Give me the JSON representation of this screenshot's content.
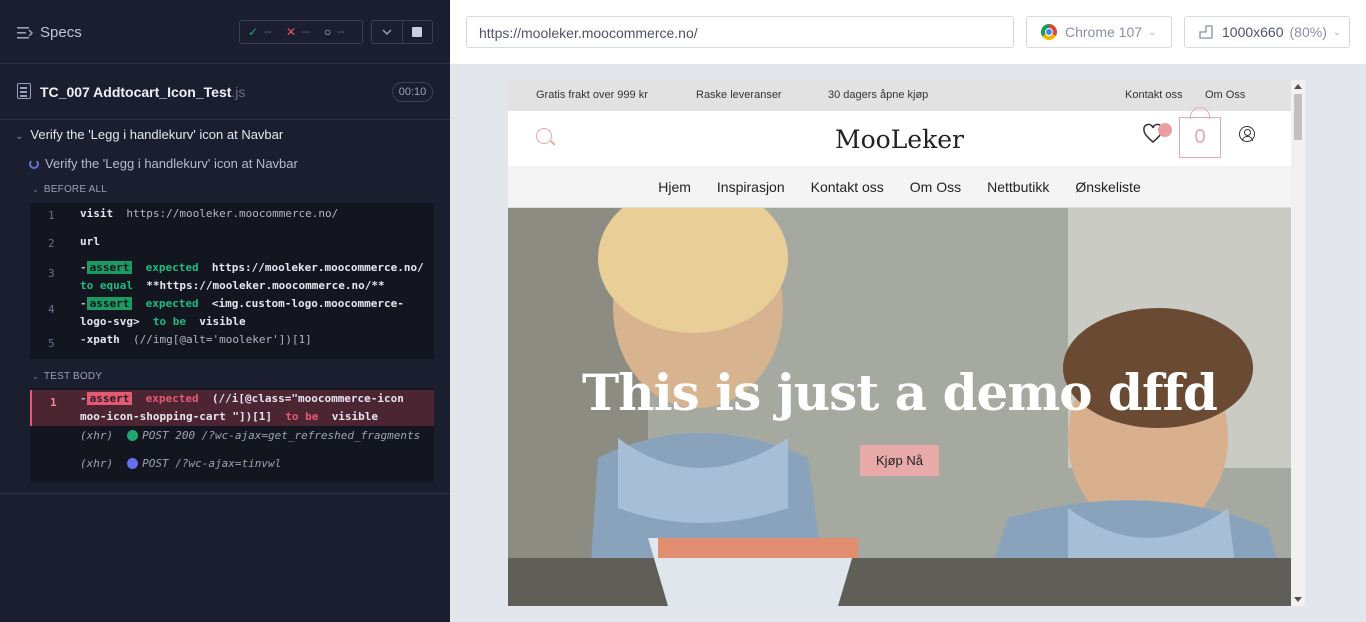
{
  "runner": {
    "specs_label": "Specs",
    "stats": {
      "passed": "--",
      "failed": "--",
      "pending": "--"
    },
    "spec_file": {
      "name": "TC_007 Addtocart_Icon_Test",
      "ext": ".js"
    },
    "duration": "00:10",
    "suite_title": "Verify the 'Legg i handlekurv' icon at Navbar",
    "test_title": "Verify the 'Legg i handlekurv' icon at Navbar",
    "before_all_label": "BEFORE ALL",
    "test_body_label": "TEST BODY",
    "before_all": [
      {
        "num": "1",
        "cmd": "visit",
        "arg": "https://mooleker.moocommerce.no/"
      },
      {
        "num": "2",
        "cmd": "url",
        "arg": ""
      },
      {
        "num": "3",
        "cmd": "assert",
        "l1_kw": "expected",
        "l1_val": "https://mooleker.moocommerce.no/",
        "l2_kw": "to equal",
        "l2_val": "**https://mooleker.moocommerce.no/**"
      },
      {
        "num": "4",
        "cmd": "assert",
        "l1_kw": "expected",
        "l1_val": "<img.custom-logo.moocommerce-",
        "l2_val": "logo-svg>",
        "l2_kw": "to be",
        "l2_tail": "visible"
      },
      {
        "num": "5",
        "cmd": "xpath",
        "arg": "(//img[@alt='mooleker'])[1]"
      }
    ],
    "test_body": {
      "num": "1",
      "cmd": "assert",
      "l1_kw": "expected",
      "l1_val": "(//i[@class=\"moocommerce-icon",
      "l2_val": "moo-icon-shopping-cart \"])[1]",
      "l2_kw": "to be",
      "l2_tail": "visible"
    },
    "xhr": [
      {
        "tag": "(xhr)",
        "text": "POST 200 /?wc-ajax=get_refreshed_fragments",
        "color": "#1fa971"
      },
      {
        "tag": "(xhr)",
        "text": "POST /?wc-ajax=tinvwl",
        "color": "#6470f0"
      }
    ]
  },
  "browser": {
    "url": "https://mooleker.moocommerce.no/",
    "name": "Chrome 107",
    "viewport": "1000x660",
    "scale": "(80%)"
  },
  "site": {
    "topbar": [
      "Gratis frakt over 999 kr",
      "Raske leveranser",
      "30 dagers åpne kjøp",
      "Kontakt oss",
      "Om Oss"
    ],
    "logo": "MooLeker",
    "cart_count": "0",
    "nav": [
      "Hjem",
      "Inspirasjon",
      "Kontakt oss",
      "Om Oss",
      "Nettbutikk",
      "Ønskeliste"
    ],
    "hero_title": "This is just a demo dffd",
    "hero_button": "Kjøp Nå"
  }
}
